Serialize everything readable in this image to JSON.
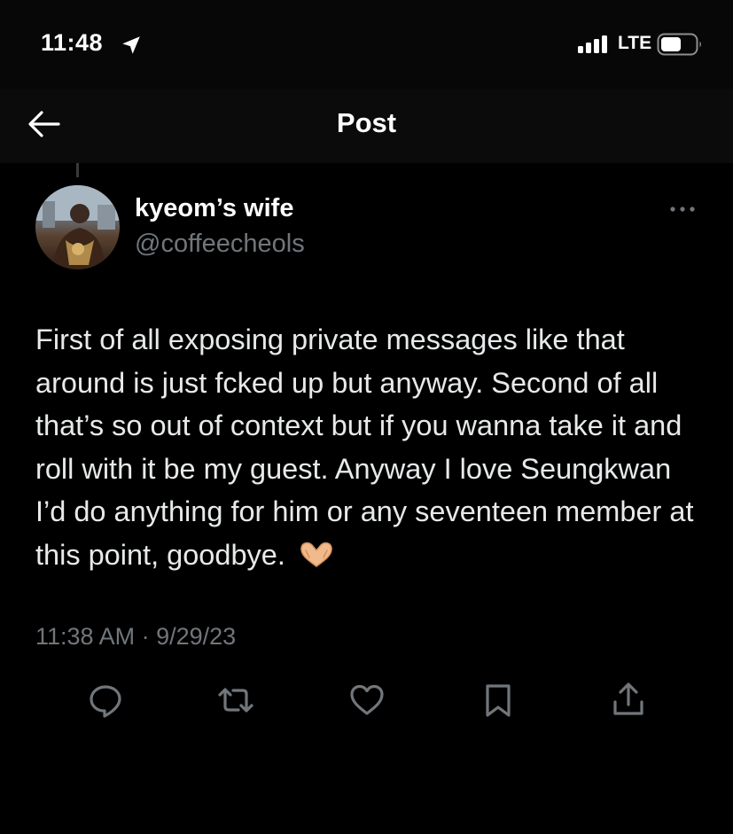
{
  "status_bar": {
    "time": "11:48",
    "network": "LTE",
    "icons": [
      "location-arrow-icon",
      "signal-bars-icon",
      "battery-icon"
    ]
  },
  "nav": {
    "title": "Post",
    "back_icon": "arrow-left-icon"
  },
  "tweet": {
    "display_name": "kyeom’s wife",
    "handle": "@coffeecheols",
    "text": "First of all exposing private messages like that around is just fcked up but anyway. Second of all that’s so out of context but if you wanna take it and roll with it be my guest. Anyway I love Seungkwan I’d do anything for him or any seventeen member at this point, goodbye.",
    "emoji": "heart-hands-emoji",
    "timestamp": "11:38 AM · 9/29/23"
  },
  "actions": [
    "reply-icon",
    "repost-icon",
    "like-icon",
    "bookmark-icon",
    "share-icon"
  ],
  "colors": {
    "background": "#000000",
    "text": "#e7e9ea",
    "muted": "#71767b",
    "icon": "#71767b"
  }
}
